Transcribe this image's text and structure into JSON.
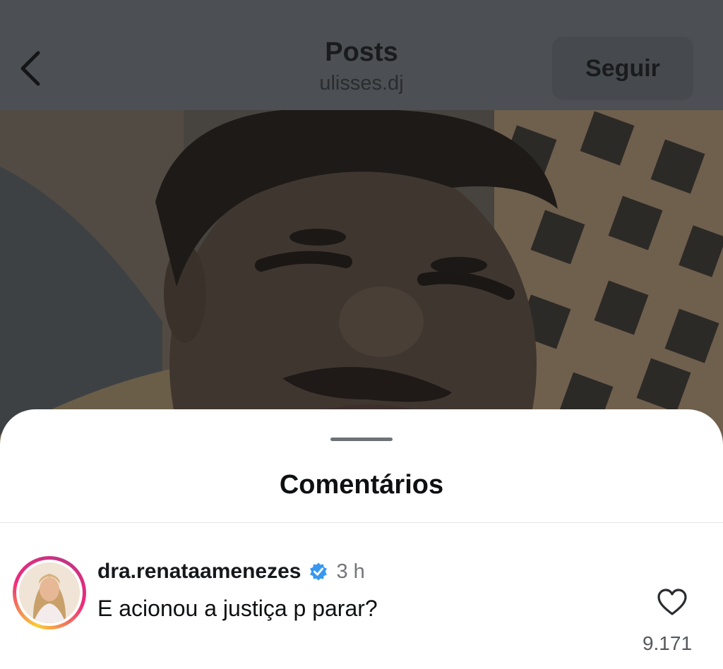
{
  "header": {
    "back_icon": "chevron-left-icon",
    "title": "Posts",
    "subtitle": "ulisses.dj",
    "follow_label": "Seguir"
  },
  "post": {
    "media": "photo"
  },
  "comments_sheet": {
    "title": "Comentários",
    "comments": [
      {
        "username": "dra.renataamenezes",
        "verified": true,
        "time": "3 h",
        "text": "E acionou a justiça p parar?",
        "like_icon": "heart-outline-icon",
        "likes": "9.171"
      }
    ]
  },
  "colors": {
    "overlay_dim": "#4c5054",
    "verified_badge": "#3897f0",
    "story_ring_start": "#f9ce34",
    "story_ring_end": "#c13584"
  }
}
